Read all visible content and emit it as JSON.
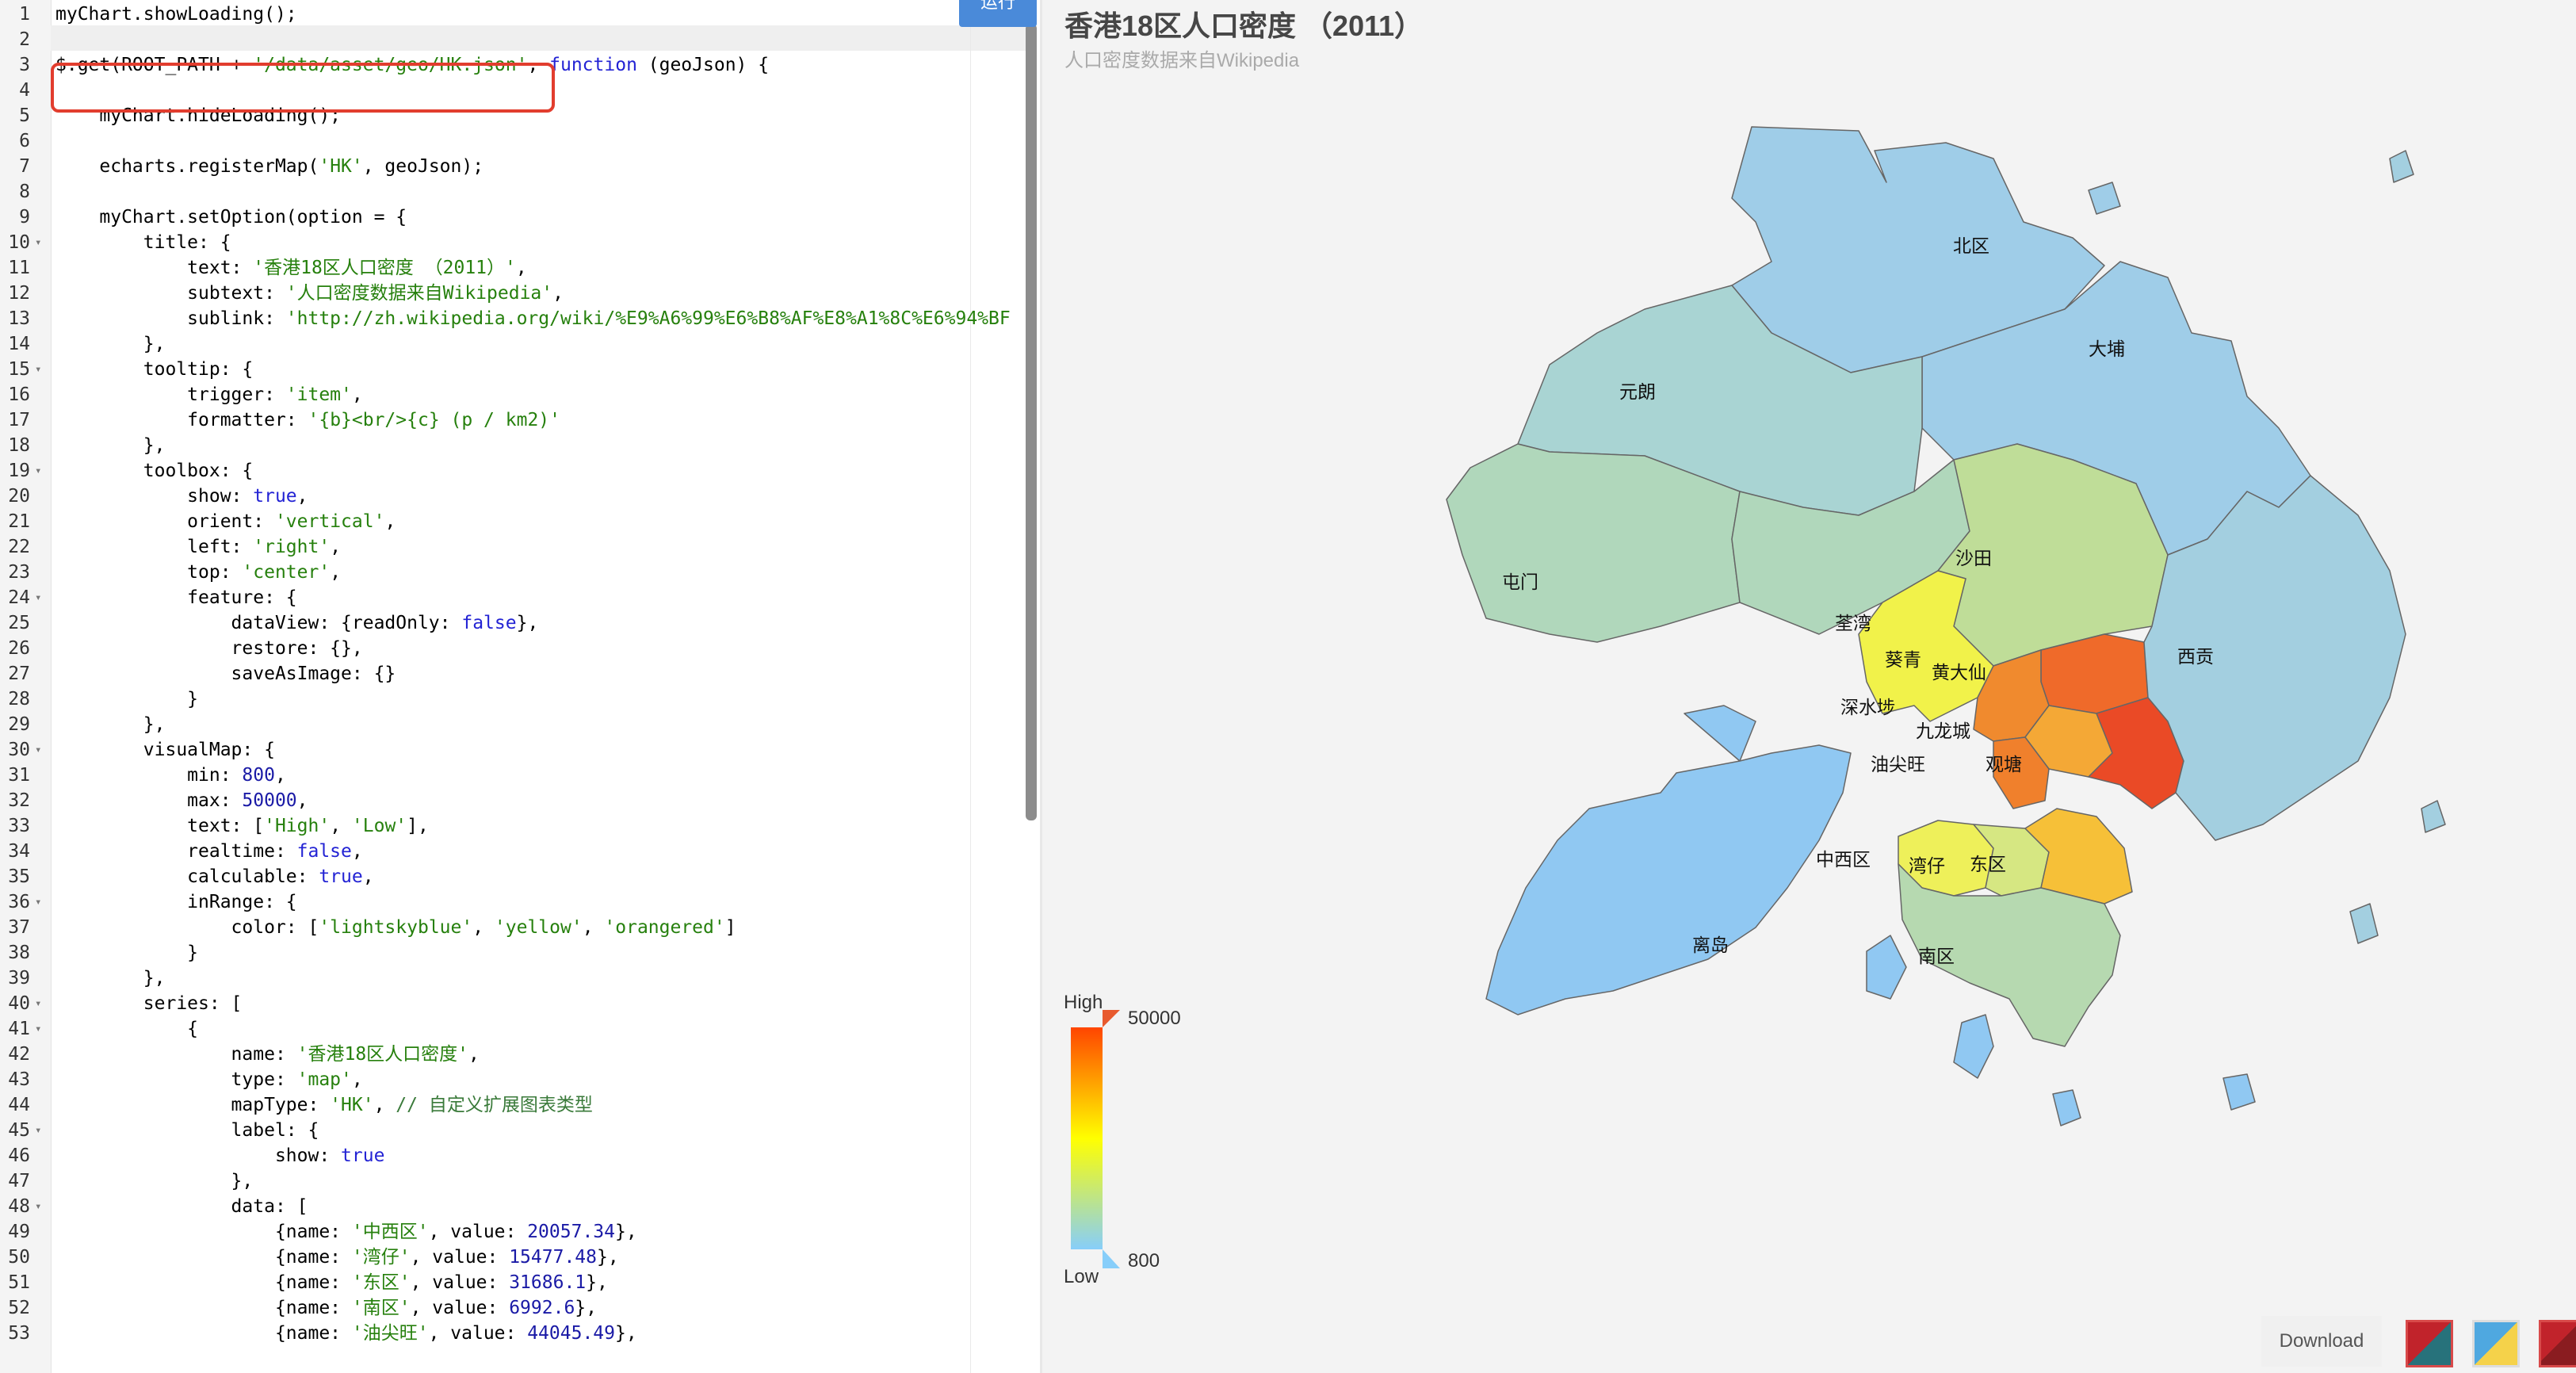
{
  "toolbar": {
    "run_label": "运行"
  },
  "editor": {
    "lines": [
      {
        "n": "1",
        "parts": [
          [
            "t",
            "myChart.showLoading();"
          ]
        ]
      },
      {
        "n": "2",
        "parts": []
      },
      {
        "n": "3",
        "parts": [
          [
            "t",
            "$.get(ROOT_PATH + "
          ],
          [
            "str",
            "'/data/asset/geo/HK.json'"
          ],
          [
            "t",
            ", "
          ],
          [
            "kw",
            "function"
          ],
          [
            "t",
            " (geoJson) {"
          ]
        ]
      },
      {
        "n": "4",
        "parts": []
      },
      {
        "n": "5",
        "parts": [
          [
            "t",
            "    myChart.hideLoading();"
          ]
        ]
      },
      {
        "n": "6",
        "parts": []
      },
      {
        "n": "7",
        "parts": [
          [
            "t",
            "    echarts.registerMap("
          ],
          [
            "str",
            "'HK'"
          ],
          [
            "t",
            ", geoJson);"
          ]
        ]
      },
      {
        "n": "8",
        "parts": []
      },
      {
        "n": "9",
        "parts": [
          [
            "t",
            "    myChart.setOption(option = {"
          ]
        ]
      },
      {
        "n": "10",
        "fold": true,
        "parts": [
          [
            "t",
            "        title: {"
          ]
        ]
      },
      {
        "n": "11",
        "parts": [
          [
            "t",
            "            text: "
          ],
          [
            "str",
            "'香港18区人口密度 （2011）'"
          ],
          [
            "t",
            ","
          ]
        ]
      },
      {
        "n": "12",
        "parts": [
          [
            "t",
            "            subtext: "
          ],
          [
            "str",
            "'人口密度数据来自Wikipedia'"
          ],
          [
            "t",
            ","
          ]
        ]
      },
      {
        "n": "13",
        "parts": [
          [
            "t",
            "            sublink: "
          ],
          [
            "str",
            "'http://zh.wikipedia.org/wiki/%E9%A6%99%E6%B8%AF%E8%A1%8C%E6%94%BF"
          ]
        ]
      },
      {
        "n": "14",
        "parts": [
          [
            "t",
            "        },"
          ]
        ]
      },
      {
        "n": "15",
        "fold": true,
        "parts": [
          [
            "t",
            "        tooltip: {"
          ]
        ]
      },
      {
        "n": "16",
        "parts": [
          [
            "t",
            "            trigger: "
          ],
          [
            "str",
            "'item'"
          ],
          [
            "t",
            ","
          ]
        ]
      },
      {
        "n": "17",
        "parts": [
          [
            "t",
            "            formatter: "
          ],
          [
            "str",
            "'{b}<br/>{c} (p / km2)'"
          ]
        ]
      },
      {
        "n": "18",
        "parts": [
          [
            "t",
            "        },"
          ]
        ]
      },
      {
        "n": "19",
        "fold": true,
        "parts": [
          [
            "t",
            "        toolbox: {"
          ]
        ]
      },
      {
        "n": "20",
        "parts": [
          [
            "t",
            "            show: "
          ],
          [
            "kw",
            "true"
          ],
          [
            "t",
            ","
          ]
        ]
      },
      {
        "n": "21",
        "parts": [
          [
            "t",
            "            orient: "
          ],
          [
            "str",
            "'vertical'"
          ],
          [
            "t",
            ","
          ]
        ]
      },
      {
        "n": "22",
        "parts": [
          [
            "t",
            "            left: "
          ],
          [
            "str",
            "'right'"
          ],
          [
            "t",
            ","
          ]
        ]
      },
      {
        "n": "23",
        "parts": [
          [
            "t",
            "            top: "
          ],
          [
            "str",
            "'center'"
          ],
          [
            "t",
            ","
          ]
        ]
      },
      {
        "n": "24",
        "fold": true,
        "parts": [
          [
            "t",
            "            feature: {"
          ]
        ]
      },
      {
        "n": "25",
        "parts": [
          [
            "t",
            "                dataView: {readOnly: "
          ],
          [
            "kw",
            "false"
          ],
          [
            "t",
            "},"
          ]
        ]
      },
      {
        "n": "26",
        "parts": [
          [
            "t",
            "                restore: {},"
          ]
        ]
      },
      {
        "n": "27",
        "parts": [
          [
            "t",
            "                saveAsImage: {}"
          ]
        ]
      },
      {
        "n": "28",
        "parts": [
          [
            "t",
            "            }"
          ]
        ]
      },
      {
        "n": "29",
        "parts": [
          [
            "t",
            "        },"
          ]
        ]
      },
      {
        "n": "30",
        "fold": true,
        "parts": [
          [
            "t",
            "        visualMap: {"
          ]
        ]
      },
      {
        "n": "31",
        "parts": [
          [
            "t",
            "            min: "
          ],
          [
            "num",
            "800"
          ],
          [
            "t",
            ","
          ]
        ]
      },
      {
        "n": "32",
        "parts": [
          [
            "t",
            "            max: "
          ],
          [
            "num",
            "50000"
          ],
          [
            "t",
            ","
          ]
        ]
      },
      {
        "n": "33",
        "parts": [
          [
            "t",
            "            text: ["
          ],
          [
            "str",
            "'High'"
          ],
          [
            "t",
            ", "
          ],
          [
            "str",
            "'Low'"
          ],
          [
            "t",
            "],"
          ]
        ]
      },
      {
        "n": "34",
        "parts": [
          [
            "t",
            "            realtime: "
          ],
          [
            "kw",
            "false"
          ],
          [
            "t",
            ","
          ]
        ]
      },
      {
        "n": "35",
        "parts": [
          [
            "t",
            "            calculable: "
          ],
          [
            "kw",
            "true"
          ],
          [
            "t",
            ","
          ]
        ]
      },
      {
        "n": "36",
        "fold": true,
        "parts": [
          [
            "t",
            "            inRange: {"
          ]
        ]
      },
      {
        "n": "37",
        "parts": [
          [
            "t",
            "                color: ["
          ],
          [
            "str",
            "'lightskyblue'"
          ],
          [
            "t",
            ", "
          ],
          [
            "str",
            "'yellow'"
          ],
          [
            "t",
            ", "
          ],
          [
            "str",
            "'orangered'"
          ],
          [
            "t",
            "]"
          ]
        ]
      },
      {
        "n": "38",
        "parts": [
          [
            "t",
            "            }"
          ]
        ]
      },
      {
        "n": "39",
        "parts": [
          [
            "t",
            "        },"
          ]
        ]
      },
      {
        "n": "40",
        "fold": true,
        "parts": [
          [
            "t",
            "        series: ["
          ]
        ]
      },
      {
        "n": "41",
        "fold": true,
        "parts": [
          [
            "t",
            "            {"
          ]
        ]
      },
      {
        "n": "42",
        "parts": [
          [
            "t",
            "                name: "
          ],
          [
            "str",
            "'香港18区人口密度'"
          ],
          [
            "t",
            ","
          ]
        ]
      },
      {
        "n": "43",
        "parts": [
          [
            "t",
            "                type: "
          ],
          [
            "str",
            "'map'"
          ],
          [
            "t",
            ","
          ]
        ]
      },
      {
        "n": "44",
        "parts": [
          [
            "t",
            "                mapType: "
          ],
          [
            "str",
            "'HK'"
          ],
          [
            "t",
            ", "
          ],
          [
            "cm",
            "// 自定义扩展图表类型"
          ]
        ]
      },
      {
        "n": "45",
        "fold": true,
        "parts": [
          [
            "t",
            "                label: {"
          ]
        ]
      },
      {
        "n": "46",
        "parts": [
          [
            "t",
            "                    show: "
          ],
          [
            "kw",
            "true"
          ]
        ]
      },
      {
        "n": "47",
        "parts": [
          [
            "t",
            "                },"
          ]
        ]
      },
      {
        "n": "48",
        "fold": true,
        "parts": [
          [
            "t",
            "                data: ["
          ]
        ]
      },
      {
        "n": "49",
        "parts": [
          [
            "t",
            "                    {name: "
          ],
          [
            "str",
            "'中西区'"
          ],
          [
            "t",
            ", value: "
          ],
          [
            "num",
            "20057.34"
          ],
          [
            "t",
            "},"
          ]
        ]
      },
      {
        "n": "50",
        "parts": [
          [
            "t",
            "                    {name: "
          ],
          [
            "str",
            "'湾仔'"
          ],
          [
            "t",
            ", value: "
          ],
          [
            "num",
            "15477.48"
          ],
          [
            "t",
            "},"
          ]
        ]
      },
      {
        "n": "51",
        "parts": [
          [
            "t",
            "                    {name: "
          ],
          [
            "str",
            "'东区'"
          ],
          [
            "t",
            ", value: "
          ],
          [
            "num",
            "31686.1"
          ],
          [
            "t",
            "},"
          ]
        ]
      },
      {
        "n": "52",
        "parts": [
          [
            "t",
            "                    {name: "
          ],
          [
            "str",
            "'南区'"
          ],
          [
            "t",
            ", value: "
          ],
          [
            "num",
            "6992.6"
          ],
          [
            "t",
            "},"
          ]
        ]
      },
      {
        "n": "53",
        "parts": [
          [
            "t",
            "                    {name: "
          ],
          [
            "str",
            "'油尖旺'"
          ],
          [
            "t",
            ", value: "
          ],
          [
            "num",
            "44045.49"
          ],
          [
            "t",
            "},"
          ]
        ]
      }
    ]
  },
  "chart": {
    "title": "香港18区人口密度 （2011）",
    "subtitle": "人口密度数据来自Wikipedia",
    "visual_map": {
      "high_text": "High",
      "low_text": "Low",
      "max_label": "50000",
      "min_label": "800"
    },
    "colors": {
      "low": "#87cefa",
      "mid": "#ffff00",
      "high": "#ff4500"
    }
  },
  "chart_data": {
    "type": "map",
    "title": "香港18区人口密度 （2011）",
    "subtitle": "人口密度数据来自Wikipedia",
    "regions": [
      {
        "name": "北区",
        "color": "#9fcde8"
      },
      {
        "name": "大埔",
        "color": "#9fcde8"
      },
      {
        "name": "元朗",
        "color": "#a9d4d3"
      },
      {
        "name": "屯门",
        "color": "#b0d7bb"
      },
      {
        "name": "沙田",
        "color": "#bfdd98"
      },
      {
        "name": "荃湾",
        "color": "#b0d7bb"
      },
      {
        "name": "葵青",
        "color": "#f1f24a"
      },
      {
        "name": "西贡",
        "color": "#a3cfe0"
      },
      {
        "name": "黄大仙",
        "color": "#ef6a2a"
      },
      {
        "name": "深水埗",
        "color": "#f08a2e"
      },
      {
        "name": "九龙城",
        "color": "#f4a836"
      },
      {
        "name": "油尖旺",
        "color": "#f0802c"
      },
      {
        "name": "观塘",
        "color": "#ea4a26"
      },
      {
        "name": "中西区",
        "color": "#eef05a"
      },
      {
        "name": "湾仔",
        "color": "#d6e782"
      },
      {
        "name": "东区",
        "color": "#f6c038"
      },
      {
        "name": "南区",
        "color": "#b6d9b0"
      },
      {
        "name": "离岛",
        "color": "#90c8f2"
      }
    ],
    "visual_map": {
      "min": 800,
      "max": 50000,
      "text": [
        "High",
        "Low"
      ]
    }
  },
  "footer": {
    "download_label": "Download"
  }
}
